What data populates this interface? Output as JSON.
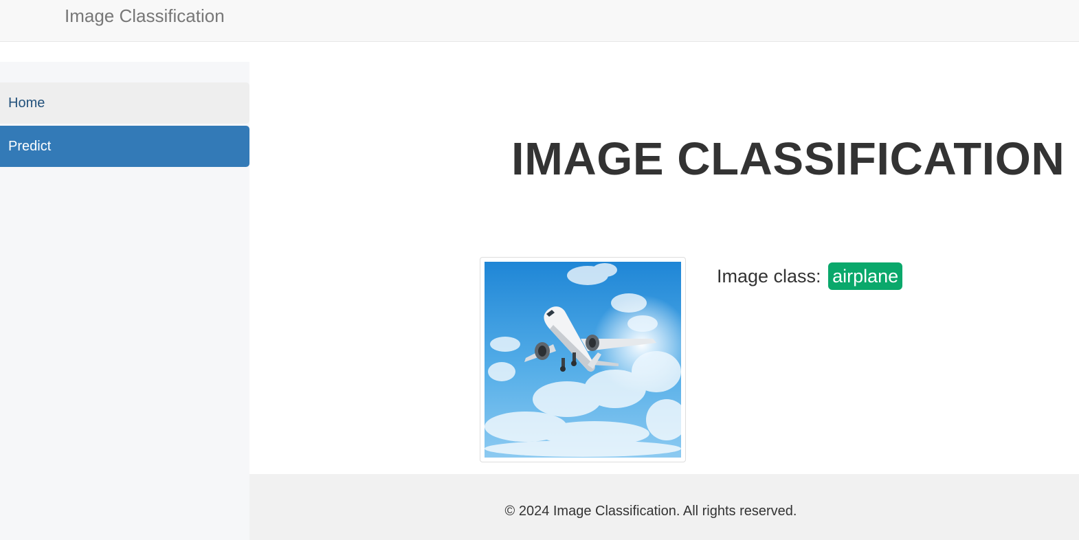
{
  "navbar": {
    "brand": "Image Classification"
  },
  "sidebar": {
    "items": [
      {
        "label": "Home",
        "active": false
      },
      {
        "label": "Predict",
        "active": true
      }
    ]
  },
  "main": {
    "title": "IMAGE CLASSIFICATION",
    "result_label": "Image class:",
    "result_value": "airplane",
    "image_subject": "airplane-photo"
  },
  "footer": {
    "text": "© 2024 Image Classification. All rights reserved."
  },
  "colors": {
    "navbar_bg": "#f8f8f8",
    "active_nav": "#337ab7",
    "badge": "#0aa86b",
    "footer_bg": "#f1f1f1"
  }
}
